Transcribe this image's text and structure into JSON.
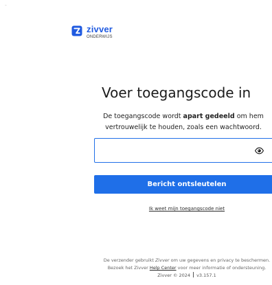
{
  "corner_mark": "-",
  "brand": {
    "name": "zivver",
    "subtitle": "ONDERWIJS",
    "color": "#1f5ae0"
  },
  "main": {
    "title": "Voer toegangscode in",
    "description_prefix": "De toegangscode wordt ",
    "description_bold": "apart gedeeld",
    "description_suffix": " om hem vertrouwelijk te houden, zoals een wachtwoord.",
    "access_code_value": "",
    "access_code_placeholder": "",
    "eye_icon": "eye-icon",
    "button_label": "Bericht ontsleutelen",
    "forgot_link": "Ik weet mijn toegangscode niet"
  },
  "footer": {
    "line1_prefix": "De verzender gebruikt ",
    "line1_brand": "Zivver",
    "line1_suffix": " om uw gegevens en privacy te beschermen.",
    "line2_prefix": "Bezoek het Zivver ",
    "line2_link": "Help Center",
    "line2_suffix": " voor meer informatie of ondersteuning.",
    "copyright": "Zivver © 2024",
    "version": "v3.157.1"
  },
  "colors": {
    "accent": "#1f6fe8",
    "text": "#1b1b1b"
  }
}
